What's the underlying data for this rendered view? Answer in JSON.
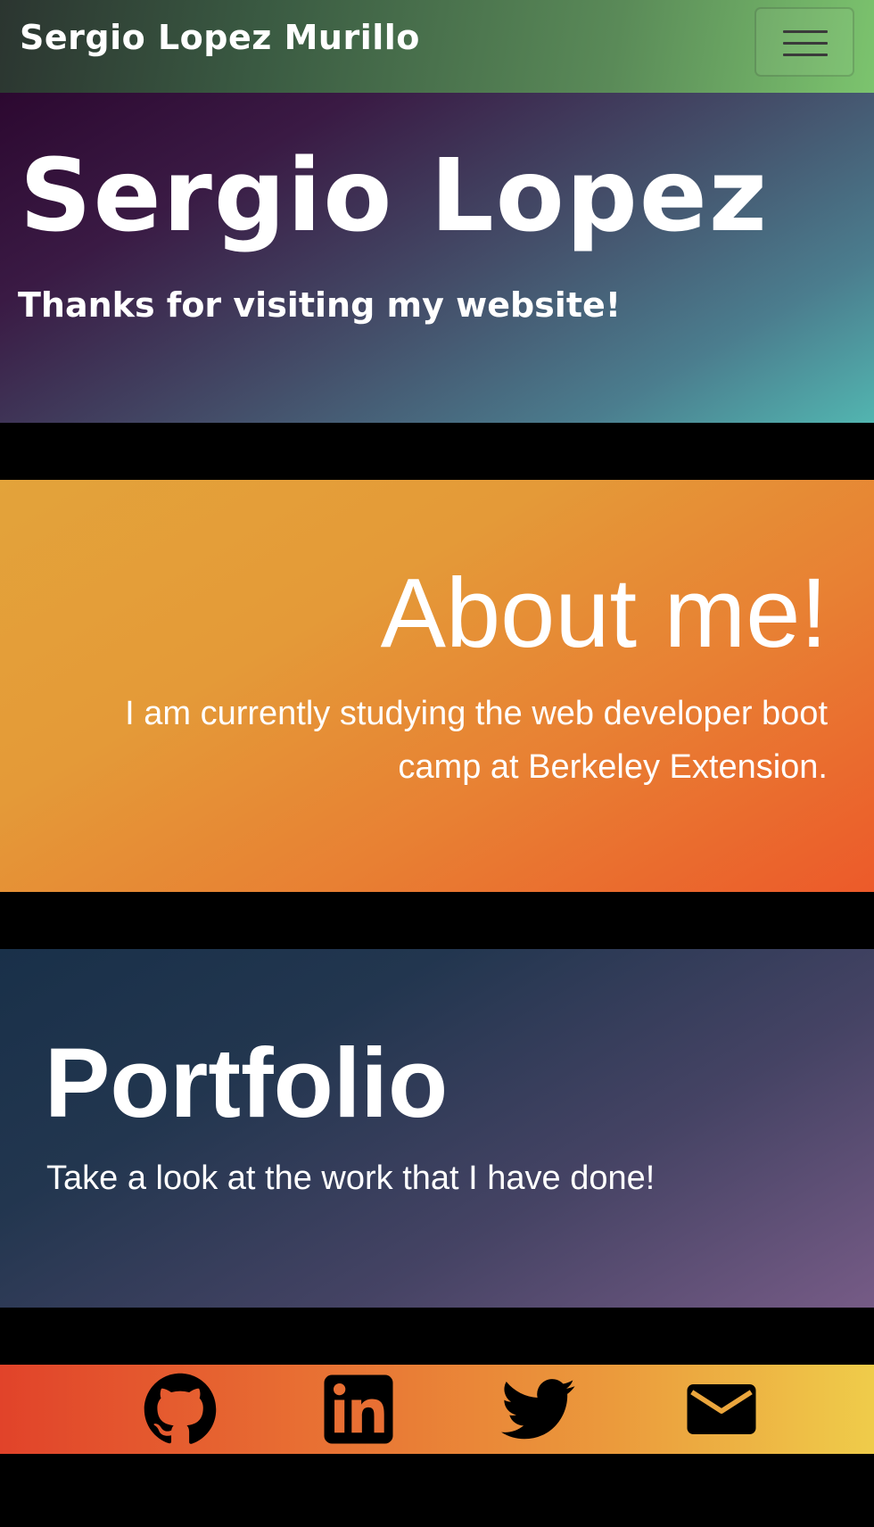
{
  "navbar": {
    "brand": "Sergio Lopez Murillo",
    "menu_icon": "hamburger-menu-icon"
  },
  "hero": {
    "title": "Sergio Lopez",
    "subtitle": "Thanks for visiting my website!"
  },
  "about": {
    "title": "About me!",
    "text": "I am currently studying the web developer boot camp at Berkeley Extension."
  },
  "portfolio": {
    "title": "Portfolio",
    "text": "Take a look at the work that I have done!"
  },
  "footer": {
    "icons": [
      "github-icon",
      "linkedin-icon",
      "twitter-icon",
      "email-icon"
    ]
  },
  "colors": {
    "page_background": "#000000",
    "text": "#ffffff",
    "icon": "#000000"
  }
}
